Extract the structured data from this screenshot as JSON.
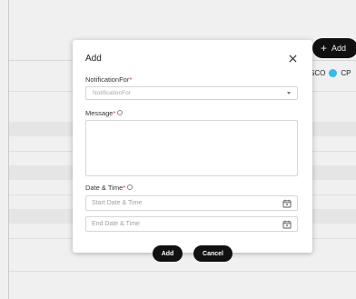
{
  "background": {
    "add_button": {
      "icon": "plus-icon",
      "label": "Add"
    },
    "legend": {
      "label_partial": "SCO",
      "item_label": "CP",
      "item_color": "#38c9f5"
    }
  },
  "modal": {
    "title": "Add",
    "close_icon": "close-icon",
    "notification_for": {
      "label": "NotificationFor",
      "required_mark": "*",
      "placeholder": "NotificationFor"
    },
    "message": {
      "label": "Message",
      "required_mark": "*",
      "info_icon": "info-icon"
    },
    "date_time": {
      "label": "Date & Time",
      "required_mark": "*",
      "info_icon": "info-icon",
      "start_placeholder": "Start Date & Time",
      "end_placeholder": "End Date & Time",
      "calendar_icon": "calendar-icon"
    },
    "buttons": {
      "add": "Add",
      "cancel": "Cancel"
    }
  }
}
